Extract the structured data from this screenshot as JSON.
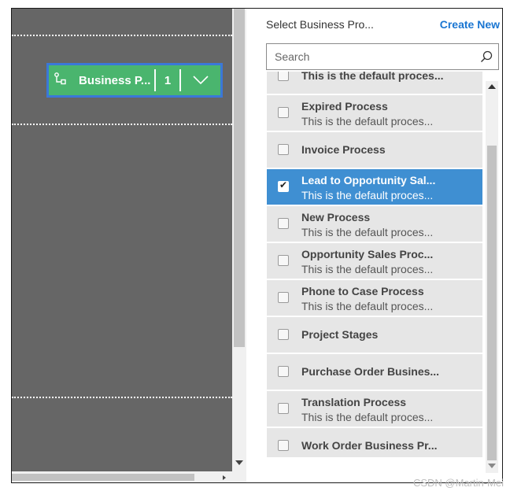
{
  "canvas": {
    "bpf_tile": {
      "label": "Business P...",
      "count": "1"
    }
  },
  "panel": {
    "title": "Select Business Pro...",
    "create_new": "Create New",
    "search": {
      "placeholder": "Search",
      "value": ""
    },
    "items": [
      {
        "title": "This is the default proces...",
        "subtitle": "",
        "checked": false
      },
      {
        "title": "Expired Process",
        "subtitle": "This is the default proces...",
        "checked": false
      },
      {
        "title": "Invoice Process",
        "subtitle": "",
        "checked": false
      },
      {
        "title": "Lead to Opportunity Sal...",
        "subtitle": "This is the default proces...",
        "checked": true
      },
      {
        "title": "New Process",
        "subtitle": "This is the default proces...",
        "checked": false
      },
      {
        "title": "Opportunity Sales Proc...",
        "subtitle": "This is the default proces...",
        "checked": false
      },
      {
        "title": "Phone to Case Process",
        "subtitle": "This is the default proces...",
        "checked": false
      },
      {
        "title": "Project Stages",
        "subtitle": "",
        "checked": false
      },
      {
        "title": "Purchase Order Busines...",
        "subtitle": "",
        "checked": false
      },
      {
        "title": "Translation Process",
        "subtitle": "This is the default proces...",
        "checked": false
      },
      {
        "title": "Work Order Business Pr...",
        "subtitle": "",
        "checked": false
      }
    ]
  },
  "watermark": "CSDN @Martin-Mei",
  "colors": {
    "canvas": "#666666",
    "tile": "#4ab56e",
    "tile_border": "#3b78d8",
    "selected": "#3f8fd2",
    "link": "#1a76d2"
  }
}
